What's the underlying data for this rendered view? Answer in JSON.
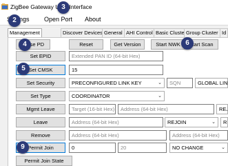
{
  "window": {
    "title": "ZigBee Gateway User Interface"
  },
  "menu": [
    "Settings",
    "Open Port",
    "About"
  ],
  "tabs": [
    "Management",
    "Discover Devices",
    "General",
    "AHI Control",
    "Basic Cluster",
    "Group Cluster",
    "Id"
  ],
  "rows": {
    "erase": {
      "erase_pd": "Erase PD",
      "reset": "Reset",
      "get_version": "Get Version",
      "start_nwk": "Start NWK",
      "start_scan": "Start Scan"
    },
    "epid": {
      "button": "Set EPID",
      "placeholder": "Extended PAN ID (64-bit Hex)"
    },
    "cmsk": {
      "button": "Set CMSK",
      "value": "15"
    },
    "security": {
      "button": "Set Security",
      "key_type": "PRECONFIGURED LINK KEY",
      "sqn_placeholder": "SQN",
      "key_label": "GLOBAL LINK"
    },
    "type": {
      "button": "Set Type",
      "value": "COORDINATOR"
    },
    "mgmt_leave": {
      "button": "Mgmt Leave",
      "target_placeholder": "Target (16-bit Hex)",
      "address_placeholder": "Address (64-bit Hex)",
      "rejoin_label": "REJOI"
    },
    "leave": {
      "button": "Leave",
      "address_placeholder": "Address (64-bit Hex)",
      "rejoin_value": "REJOIN",
      "second_value": "R"
    },
    "remove": {
      "button": "Remove",
      "address1_placeholder": "Address (64-bit Hex)",
      "address2_placeholder": "Address (64-bit Hex)"
    },
    "permit_join": {
      "button": "Permit Join",
      "value1": "0",
      "value2": "20",
      "change_value": "NO CHANGE"
    },
    "permit_join_state": {
      "button": "Permit Join State"
    }
  },
  "badges": [
    "2",
    "3",
    "4",
    "5",
    "6",
    "9"
  ],
  "colors": {
    "badge": "#2c3a78",
    "focus_border": "#0078d7",
    "form_bg": "#f0f0f0"
  }
}
